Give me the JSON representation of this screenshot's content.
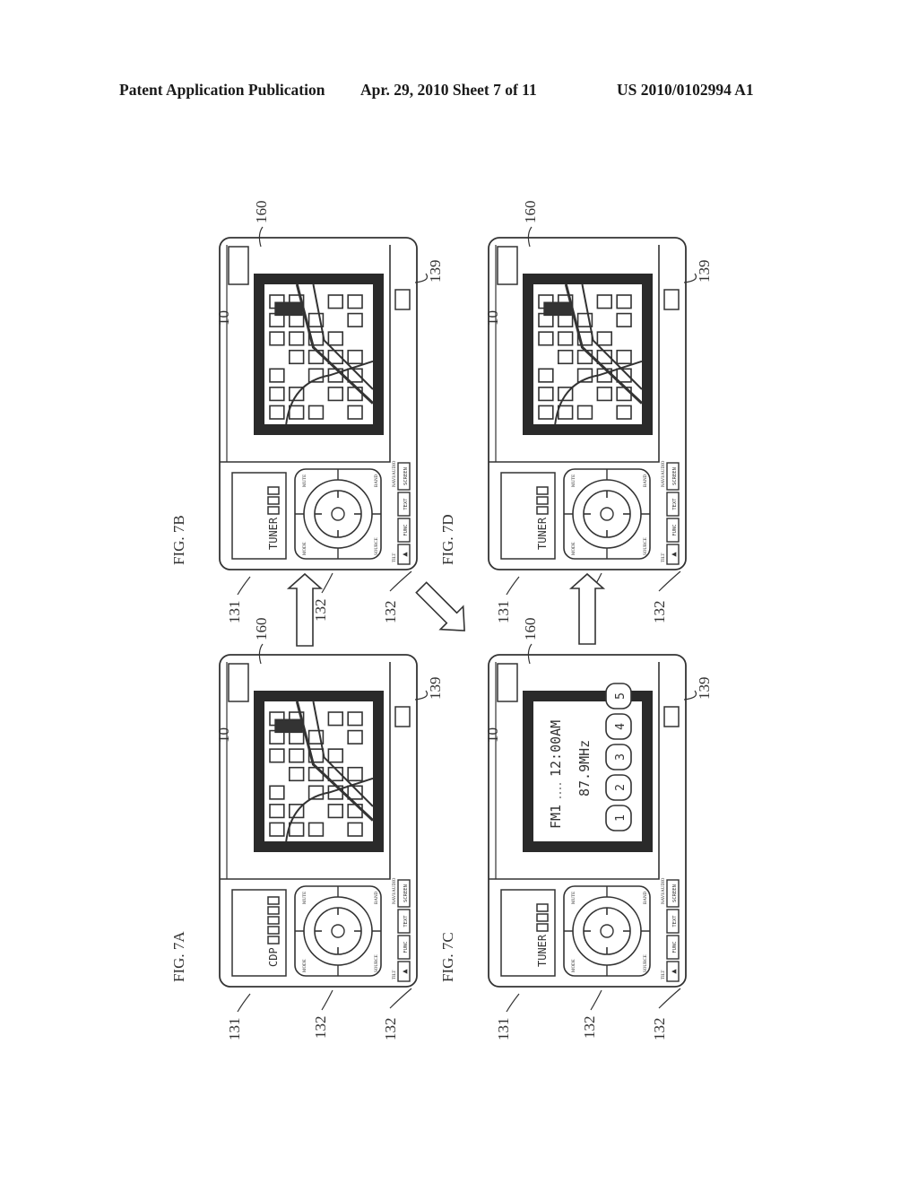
{
  "header": {
    "publication": "Patent Application Publication",
    "date_sheet": "Apr. 29, 2010  Sheet 7 of 11",
    "number": "US 2010/0102994 A1"
  },
  "figures": [
    {
      "id": "7B",
      "label": "FIG. 7B",
      "source_box_text": "TUNER",
      "source_indicators": 3,
      "screen": "map",
      "refs": {
        "device": "10",
        "source_box": "131",
        "controller": "132",
        "buttons": "132",
        "sensor": "160",
        "knob": "139"
      }
    },
    {
      "id": "7D",
      "label": "FIG. 7D",
      "source_box_text": "TUNER",
      "source_indicators": 3,
      "screen": "map",
      "refs": {
        "device": "10",
        "source_box": "131",
        "controller": "132",
        "buttons": "132",
        "sensor": "160",
        "knob": "139"
      }
    },
    {
      "id": "7A",
      "label": "FIG. 7A",
      "source_box_text": "CDP",
      "source_indicators": 5,
      "screen": "map",
      "refs": {
        "device": "10",
        "source_box": "131",
        "controller": "132",
        "buttons": "132",
        "sensor": "160",
        "knob": "139"
      }
    },
    {
      "id": "7C",
      "label": "FIG. 7C",
      "source_box_text": "TUNER",
      "source_indicators": 3,
      "screen": "radio",
      "radio": {
        "band": "FM1",
        "time": "12:00AM",
        "frequency": "87.9MHz",
        "presets": [
          "1",
          "2",
          "3",
          "4",
          "5"
        ]
      },
      "refs": {
        "device": "10",
        "source_box": "131",
        "controller": "132",
        "buttons": "132",
        "sensor": "160",
        "knob": "139"
      }
    }
  ],
  "device_controls": {
    "dpad_labels": [
      "SOURCE PWR",
      "MODE",
      "BAND",
      "MUTE"
    ],
    "function_strip_label": "TILT",
    "mode_label": "NAVI/AUDIO",
    "function_buttons": [
      "▲",
      "FUNC",
      "TEXT",
      "SCREEN"
    ]
  },
  "arrows": [
    {
      "from": "7A",
      "to": "7B",
      "direction": "up"
    },
    {
      "from": "7B",
      "to": "7C",
      "direction": "down-right"
    },
    {
      "from": "7C",
      "to": "7D",
      "direction": "up"
    }
  ]
}
